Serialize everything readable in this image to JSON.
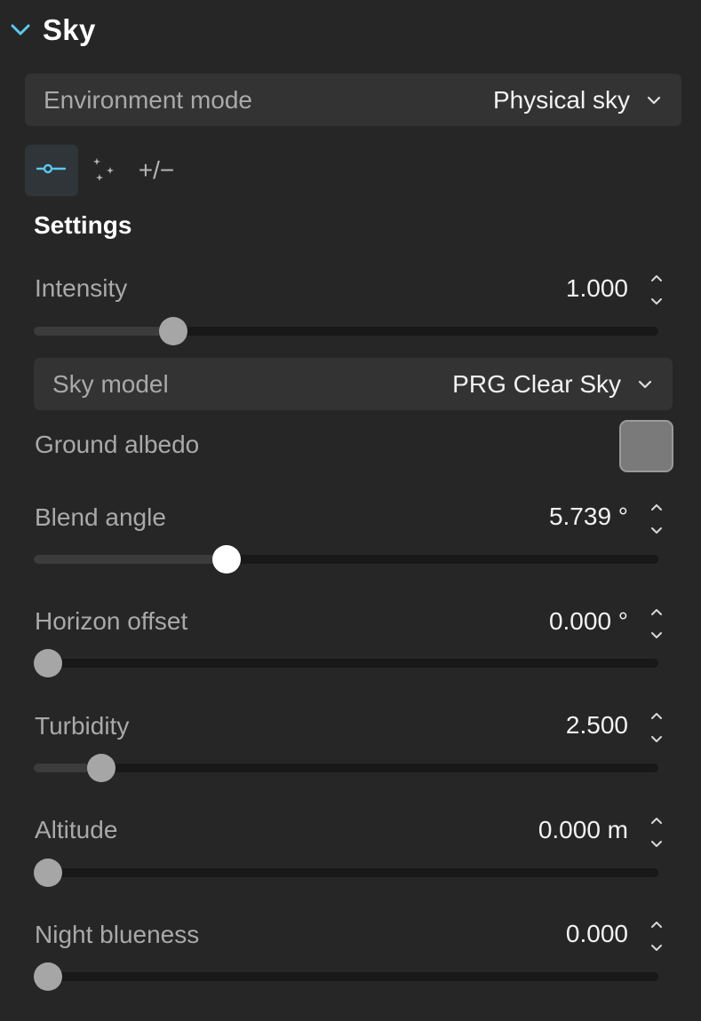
{
  "section": {
    "title": "Sky",
    "icon": "chevron-down-icon"
  },
  "environment_mode": {
    "label": "Environment mode",
    "value": "Physical sky"
  },
  "tabs": [
    {
      "name": "sliders",
      "icon": "sliders-icon",
      "active": true
    },
    {
      "name": "sparkles",
      "icon": "sparkles-icon",
      "active": false
    },
    {
      "name": "plus-minus",
      "text": "+/−",
      "active": false
    }
  ],
  "settings": {
    "heading": "Settings"
  },
  "sky_model": {
    "label": "Sky model",
    "value": "PRG Clear Sky"
  },
  "ground_albedo": {
    "label": "Ground albedo",
    "color": "#7a7a7a"
  },
  "params": {
    "intensity": {
      "label": "Intensity",
      "value": "1.000",
      "slider_fraction": 0.21
    },
    "blend_angle": {
      "label": "Blend angle",
      "value": "5.739 °",
      "slider_fraction": 0.3
    },
    "horizon_offset": {
      "label": "Horizon offset",
      "value": "0.000 °",
      "slider_fraction": 0.0
    },
    "turbidity": {
      "label": "Turbidity",
      "value": "2.500",
      "slider_fraction": 0.09
    },
    "altitude": {
      "label": "Altitude",
      "value": "0.000 m",
      "slider_fraction": 0.0
    },
    "night_blueness": {
      "label": "Night blueness",
      "value": "0.000",
      "slider_fraction": 0.0
    }
  },
  "colors": {
    "accent": "#5cc8f0",
    "background": "#262626"
  }
}
